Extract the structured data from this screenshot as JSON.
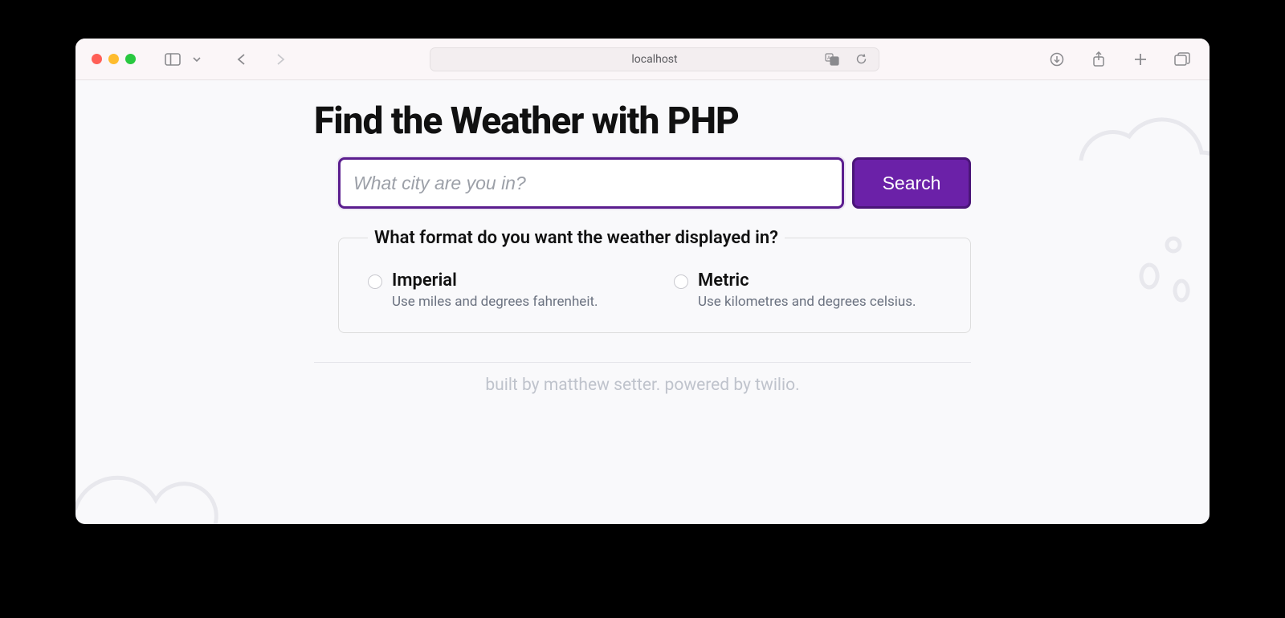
{
  "browser": {
    "address": "localhost"
  },
  "page": {
    "title": "Find the Weather with PHP",
    "search": {
      "placeholder": "What city are you in?",
      "button_label": "Search"
    },
    "format": {
      "legend": "What format do you want the weather displayed in?",
      "options": [
        {
          "label": "Imperial",
          "desc": "Use miles and degrees fahrenheit."
        },
        {
          "label": "Metric",
          "desc": "Use kilometres and degrees celsius."
        }
      ]
    },
    "footer": "built by matthew setter. powered by twilio."
  },
  "colors": {
    "accent": "#6b21a8",
    "accent_border": "#5b1e8f"
  }
}
